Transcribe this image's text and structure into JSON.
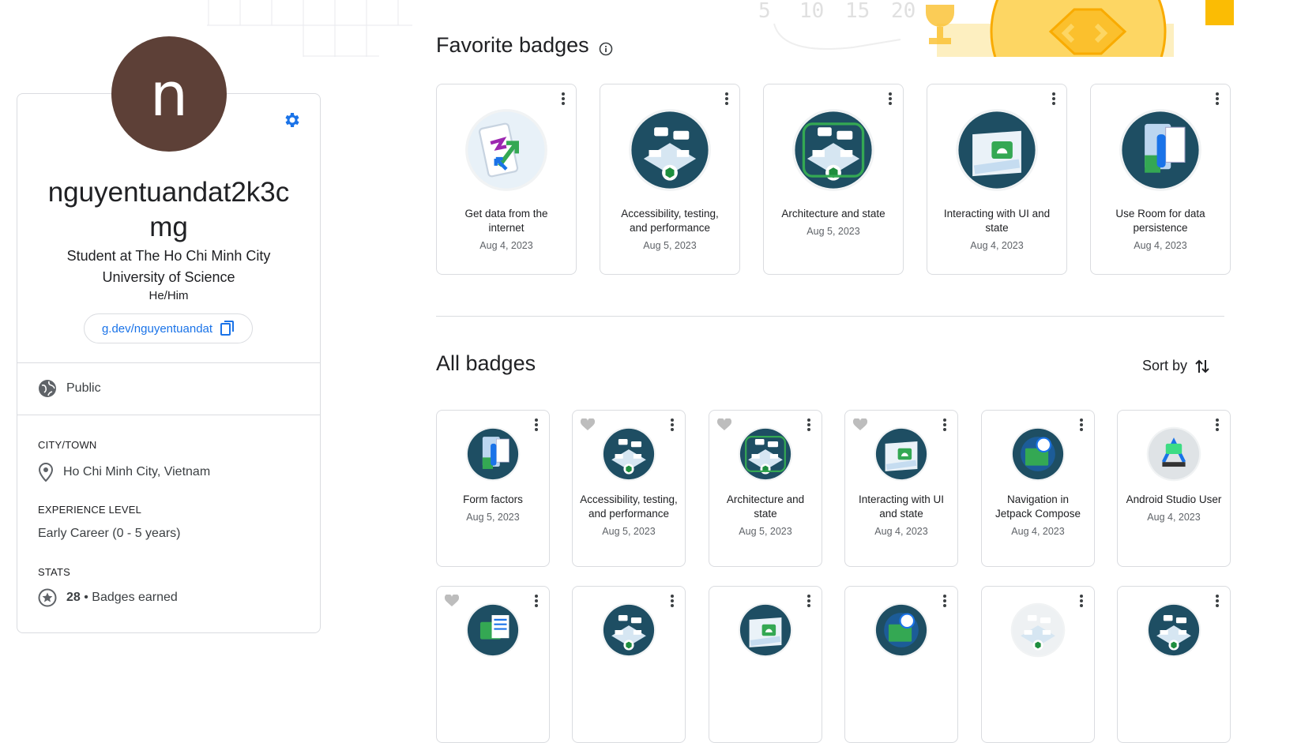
{
  "profile": {
    "avatar_letter": "n",
    "username": "nguyentuandat2k3cmg",
    "tagline": "Student at The Ho Chi Minh City University of Science",
    "pronouns": "He/Him",
    "link": "g.dev/nguyentuandat",
    "visibility": "Public",
    "city_label": "CITY/TOWN",
    "city": "Ho Chi Minh City, Vietnam",
    "experience_label": "EXPERIENCE LEVEL",
    "experience": "Early Career (0 - 5 years)",
    "stats_label": "STATS",
    "badges_count": "28",
    "badges_earned_label": "• Badges earned"
  },
  "favorites": {
    "title": "Favorite badges",
    "items": [
      {
        "title": "Get data from the internet",
        "date": "Aug 4, 2023",
        "icon": "data-internet-badge"
      },
      {
        "title": "Accessibility, testing, and performance",
        "date": "Aug 5, 2023",
        "icon": "accessibility-badge"
      },
      {
        "title": "Architecture and state",
        "date": "Aug 5, 2023",
        "icon": "architecture-badge"
      },
      {
        "title": "Interacting with UI and state",
        "date": "Aug 4, 2023",
        "icon": "ui-state-badge"
      },
      {
        "title": "Use Room for data persistence",
        "date": "Aug 4, 2023",
        "icon": "room-badge"
      }
    ]
  },
  "all": {
    "title": "All badges",
    "sort_label": "Sort by",
    "items": [
      {
        "title": "Form factors",
        "date": "Aug 5, 2023"
      },
      {
        "title": "Accessibility, testing, and performance",
        "date": "Aug 5, 2023"
      },
      {
        "title": "Architecture and state",
        "date": "Aug 5, 2023"
      },
      {
        "title": "Interacting with UI and state",
        "date": "Aug 4, 2023"
      },
      {
        "title": "Navigation in Jetpack Compose",
        "date": "Aug 4, 2023"
      },
      {
        "title": "Android Studio User",
        "date": "Aug 4, 2023"
      }
    ]
  },
  "colors": {
    "accent": "#1a73e8",
    "avatar": "#5d4037",
    "badge_dark": "#1e4e63",
    "badge_green": "#34a853"
  }
}
